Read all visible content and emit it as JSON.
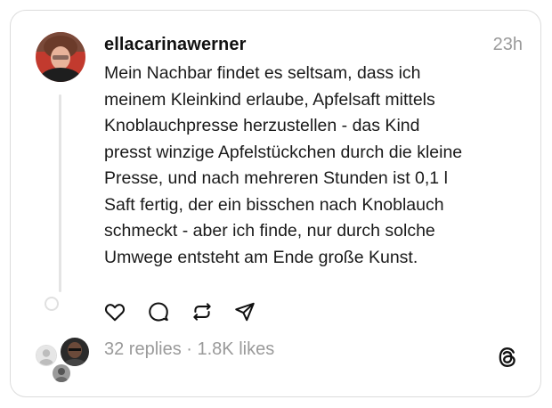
{
  "post": {
    "username": "ellacarinawerner",
    "timestamp": "23h",
    "lines": [
      "Mein Nachbar findet es seltsam, dass ich",
      "meinem Kleinkind erlaube, Apfelsaft mittels",
      "Knoblauchpresse herzustellen - das Kind",
      "presst winzige Apfelstückchen durch die kleine",
      "Presse, und nach mehreren Stunden ist 0,1 l",
      "Saft fertig, der ein bisschen nach Knoblauch",
      "schmeckt - aber ich finde, nur durch solche",
      "Umwege entsteht am Ende große Kunst."
    ]
  },
  "actions": {
    "icons": [
      "heart-icon",
      "comment-icon",
      "repost-icon",
      "share-icon"
    ]
  },
  "stats": {
    "replies": "32 replies",
    "separator": " · ",
    "likes": "1.8K likes"
  },
  "colors": {
    "text": "#1a1a1a",
    "muted": "#9a9a9a",
    "border": "#dcdcdc",
    "thread_line": "#e4e4e4"
  },
  "brand": {
    "logo_icon": "threads-logo-icon"
  }
}
